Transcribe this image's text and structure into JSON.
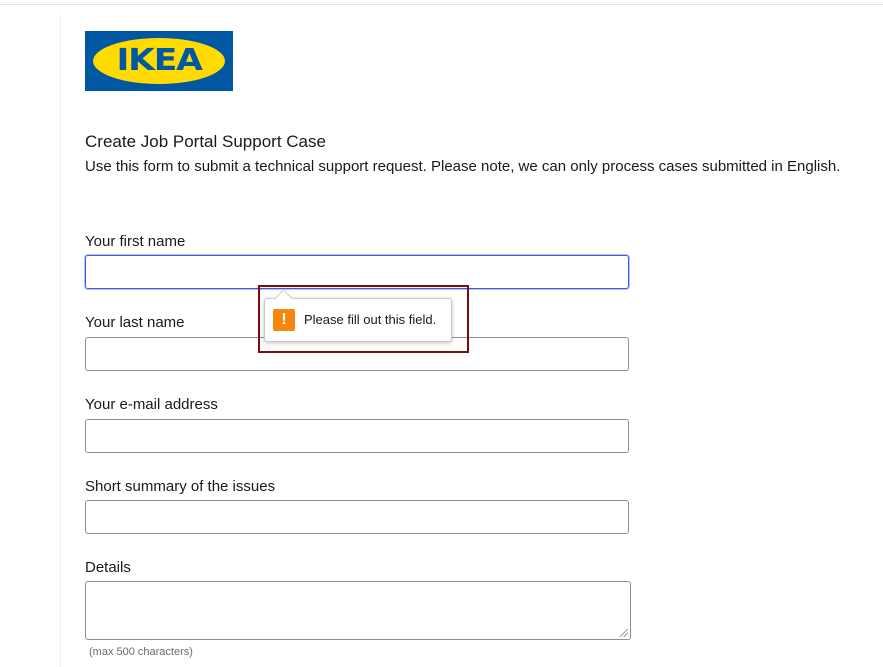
{
  "logo": {
    "text": "IKEA",
    "reg_mark": "®",
    "colors": {
      "background": "#0058a3",
      "oval": "#ffdb00"
    }
  },
  "form": {
    "title": "Create Job Portal Support Case",
    "description": "Use this form to submit a technical support request. Please note, we can only process cases submitted in English.",
    "fields": {
      "first_name": {
        "label": "Your first name",
        "value": ""
      },
      "last_name": {
        "label": "Your last name",
        "value": ""
      },
      "email": {
        "label": "Your e-mail address",
        "value": ""
      },
      "summary": {
        "label": "Short summary of the issues",
        "value": ""
      },
      "details": {
        "label": "Details",
        "value": "",
        "hint": "(max 500 characters)"
      }
    }
  },
  "validation_tooltip": {
    "message": "Please fill out this field.",
    "icon": "warning-icon",
    "icon_glyph": "!",
    "icon_color": "#f5870f"
  },
  "annotation": {
    "highlight_color": "#7d0b0b"
  }
}
